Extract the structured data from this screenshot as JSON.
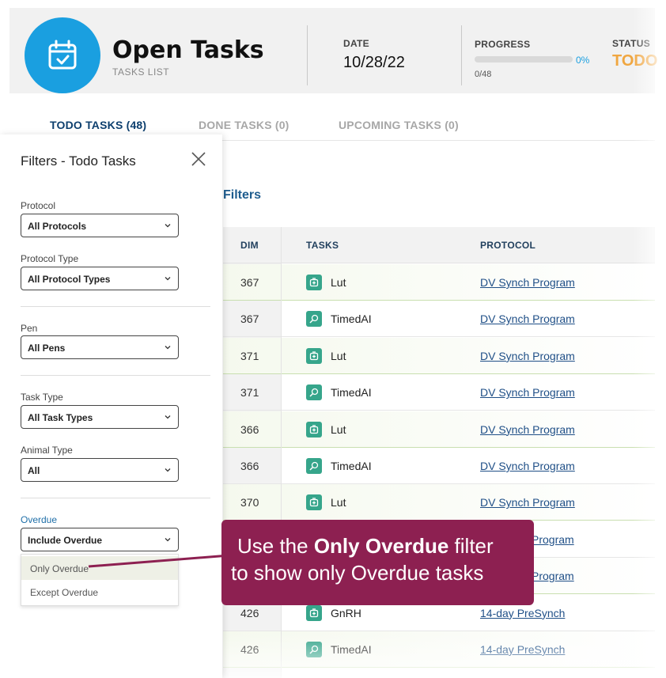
{
  "header": {
    "title": "Open Tasks",
    "subtitle": "TASKS LIST",
    "date_label": "DATE",
    "date_value": "10/28/22",
    "progress_label": "PROGRESS",
    "progress_percent_text": "0%",
    "progress_fraction": 0,
    "progress_count": "0/48",
    "status_label": "STATUS",
    "status_value": "TODO",
    "icon": "calendar-check-icon",
    "accent_color": "#1a9fe0"
  },
  "tabs": [
    {
      "label": "TODO TASKS (48)",
      "active": true
    },
    {
      "label": "DONE TASKS (0)",
      "active": false
    },
    {
      "label": "UPCOMING TASKS (0)",
      "active": false
    }
  ],
  "filters_link": "Filters",
  "table": {
    "columns": [
      "DIM",
      "TASKS",
      "PROTOCOL"
    ],
    "rows": [
      {
        "dim": "367",
        "task": "Lut",
        "icon": "syringe-icon",
        "protocol": "DV Synch Program"
      },
      {
        "dim": "367",
        "task": "TimedAI",
        "icon": "inseminate-icon",
        "protocol": "DV Synch Program"
      },
      {
        "dim": "371",
        "task": "Lut",
        "icon": "syringe-icon",
        "protocol": "DV Synch Program"
      },
      {
        "dim": "371",
        "task": "TimedAI",
        "icon": "inseminate-icon",
        "protocol": "DV Synch Program"
      },
      {
        "dim": "366",
        "task": "Lut",
        "icon": "syringe-icon",
        "protocol": "DV Synch Program"
      },
      {
        "dim": "366",
        "task": "TimedAI",
        "icon": "inseminate-icon",
        "protocol": "DV Synch Program"
      },
      {
        "dim": "370",
        "task": "Lut",
        "icon": "syringe-icon",
        "protocol": "DV Synch Program"
      },
      {
        "dim": "",
        "task": "",
        "icon": "",
        "protocol": "Program"
      },
      {
        "dim": "",
        "task": "",
        "icon": "",
        "protocol": "Program"
      },
      {
        "dim": "426",
        "task": "GnRH",
        "icon": "syringe-icon",
        "protocol": "14-day PreSynch"
      },
      {
        "dim": "426",
        "task": "TimedAI",
        "icon": "inseminate-icon",
        "protocol": "14-day PreSynch"
      }
    ]
  },
  "filter_panel": {
    "title": "Filters - Todo Tasks",
    "protocol_label": "Protocol",
    "protocol_value": "All Protocols",
    "protocol_type_label": "Protocol Type",
    "protocol_type_value": "All Protocol Types",
    "pen_label": "Pen",
    "pen_value": "All Pens",
    "task_type_label": "Task Type",
    "task_type_value": "All Task Types",
    "animal_type_label": "Animal Type",
    "animal_type_value": "All",
    "overdue_label": "Overdue",
    "overdue_value": "Include Overdue",
    "overdue_options": [
      "Only Overdue",
      "Except Overdue"
    ]
  },
  "callout": {
    "prefix": "Use the ",
    "bold": "Only Overdue",
    "suffix": " filter",
    "line2": "to show only Overdue tasks",
    "color": "#8d2051"
  }
}
